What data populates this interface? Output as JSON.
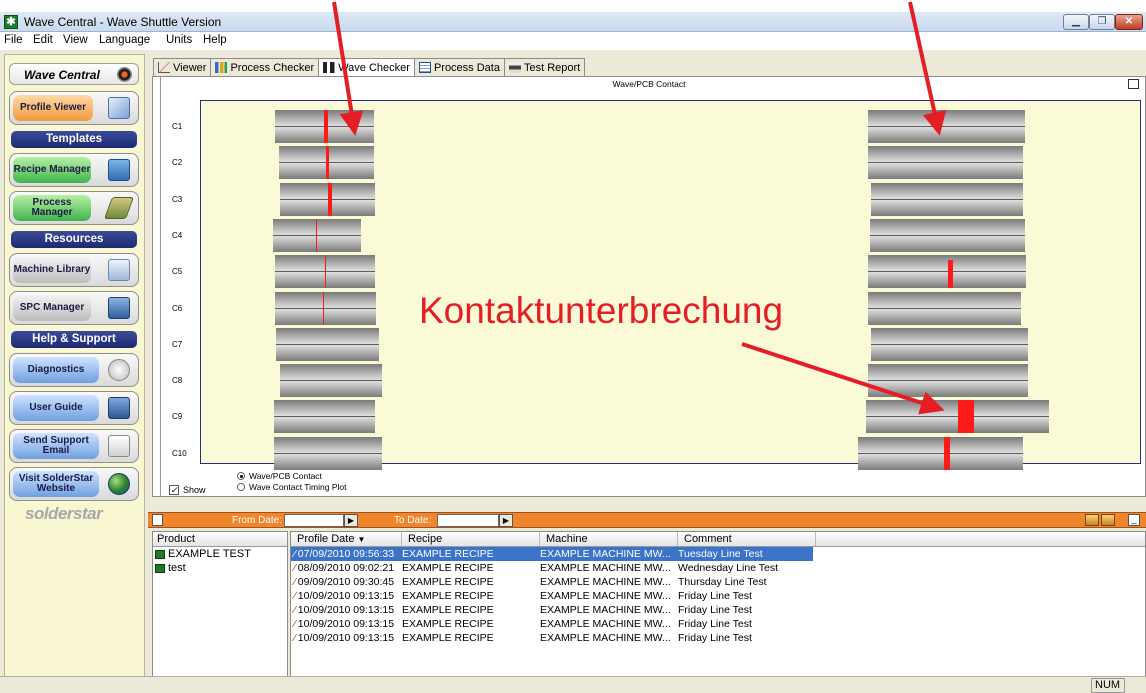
{
  "window": {
    "title": "Wave Central - Wave Shuttle Version"
  },
  "menu": [
    "File",
    "Edit",
    "View",
    "Language",
    "Units",
    "Help"
  ],
  "sidebar": {
    "header": "Wave Central",
    "sections": {
      "templates": "Templates",
      "resources": "Resources",
      "help": "Help & Support"
    },
    "buttons": {
      "profile_viewer": "Profile Viewer",
      "recipe_manager": "Recipe Manager",
      "process_manager": "Process Manager",
      "machine_library": "Machine Library",
      "spc_manager": "SPC Manager",
      "diagnostics": "Diagnostics",
      "user_guide": "User Guide",
      "send_support": "Send Support Email",
      "visit_website": "Visit SolderStar Website"
    },
    "logo": "solderstar"
  },
  "tabs": [
    "Viewer",
    "Process Checker",
    "Wave Checker",
    "Process Data",
    "Test Report"
  ],
  "chart": {
    "title": "Wave/PCB Contact",
    "rows": [
      "C1",
      "C2",
      "C3",
      "C4",
      "C5",
      "C6",
      "C7",
      "C8",
      "C9",
      "C10"
    ],
    "options": [
      "Wave/PCB Contact",
      "Wave Contact Timing Plot"
    ],
    "selected_option": "Wave/PCB Contact",
    "show_label": "Show",
    "show_checked": true
  },
  "annotation": {
    "text": "Kontaktunterbrechung",
    "color": "#e51e26"
  },
  "filter": {
    "from_label": "From Date:",
    "to_label": "To Date:"
  },
  "products": {
    "header": "Product",
    "items": [
      "EXAMPLE TEST",
      "test"
    ]
  },
  "grid": {
    "columns": [
      "Profile Date",
      "Recipe",
      "Machine",
      "Comment"
    ],
    "rows": [
      {
        "date": "07/09/2010 09:56:33",
        "recipe": "EXAMPLE RECIPE",
        "machine": "EXAMPLE MACHINE MW...",
        "comment": "Tuesday Line Test",
        "selected": true
      },
      {
        "date": "08/09/2010 09:02:21",
        "recipe": "EXAMPLE RECIPE",
        "machine": "EXAMPLE MACHINE MW...",
        "comment": "Wednesday Line Test"
      },
      {
        "date": "09/09/2010 09:30:45",
        "recipe": "EXAMPLE RECIPE",
        "machine": "EXAMPLE MACHINE MW...",
        "comment": "Thursday Line Test"
      },
      {
        "date": "10/09/2010 09:13:15",
        "recipe": "EXAMPLE RECIPE",
        "machine": "EXAMPLE MACHINE MW...",
        "comment": "Friday Line Test"
      },
      {
        "date": "10/09/2010 09:13:15",
        "recipe": "EXAMPLE RECIPE",
        "machine": "EXAMPLE MACHINE MW...",
        "comment": "Friday Line Test"
      },
      {
        "date": "10/09/2010 09:13:15",
        "recipe": "EXAMPLE RECIPE",
        "machine": "EXAMPLE MACHINE MW...",
        "comment": "Friday Line Test"
      },
      {
        "date": "10/09/2010 09:13:15",
        "recipe": "EXAMPLE RECIPE",
        "machine": "EXAMPLE MACHINE MW...",
        "comment": "Friday Line Test"
      }
    ]
  },
  "status": {
    "num": "NUM"
  },
  "colors": {
    "accent_orange": "#f0852b",
    "selection_blue": "#3a73c8",
    "contact_red": "#ff1a1a",
    "plot_bg": "#fafad6"
  }
}
